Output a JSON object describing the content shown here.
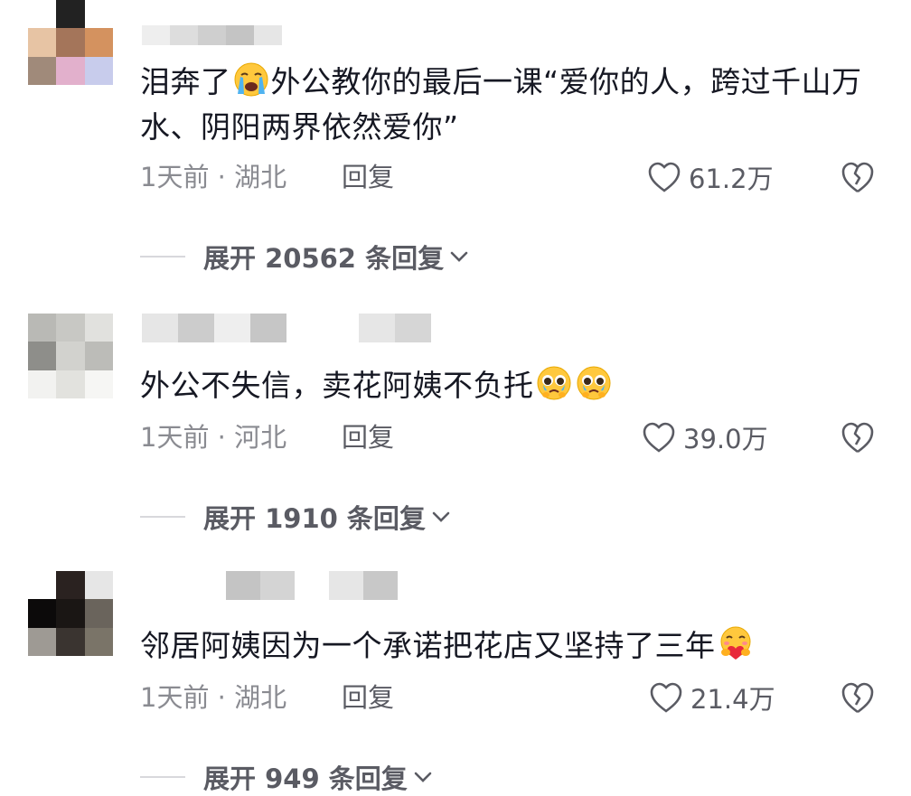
{
  "comments": [
    {
      "username": "",
      "avatar_colors": [
        "#ffffff",
        "#222222",
        "#ffffff",
        "#e7c4a4",
        "#a4755a",
        "#d4925f",
        "#a08a7a",
        "#e2b0cc",
        "#c8ccec"
      ],
      "username_blocks": [
        "#eeeeee",
        "#dddddd",
        "#cfcfcf",
        "#c4c4c4",
        "#e6e6e6"
      ],
      "text_before": "泪奔了",
      "emoji": "crying-face-emoji",
      "text_after": "外公教你的最后一课“爱你的人，跨过千山万水、阴阳两界依然爱你”",
      "time": "1天前 · 湖北",
      "reply_label": "回复",
      "likes": "61.2万",
      "expand_label": "展开 20562 条回复"
    },
    {
      "username": "",
      "avatar_colors": [
        "#b9b9b5",
        "#c8c8c4",
        "#e1e1de",
        "#8e8e8a",
        "#d2d2ce",
        "#bcbcb8",
        "#f2f2f0",
        "#e2e2de",
        "#f6f6f4"
      ],
      "username_blocks": [
        "#e6e6e6",
        "#cccccc",
        "#eeeeee",
        "#c6c6c6",
        "#ffffff",
        "#ffffff",
        "#e6e6e6",
        "#d6d6d6"
      ],
      "text": "外公不失信，卖花阿姨不负托",
      "emojis": [
        "pleading-tears-emoji",
        "pleading-tears-emoji"
      ],
      "time": "1天前 · 河北",
      "reply_label": "回复",
      "likes": "39.0万",
      "expand_label": "展开 1910 条回复"
    },
    {
      "username": "",
      "avatar_colors": [
        "#ffffff",
        "#2a2220",
        "#e6e6e6",
        "#0c0a0a",
        "#1a1614",
        "#6a645c",
        "#9e9a94",
        "#3a3430",
        "#7a7468"
      ],
      "username_blocks": [
        "#c4c4c4",
        "#d4d4d4",
        "#ffffff",
        "#e6e6e6",
        "#c8c8c8"
      ],
      "text": "邻居阿姨因为一个承诺把花店又坚持了三年",
      "emoji": "hugging-heart-emoji",
      "time": "1天前 · 湖北",
      "reply_label": "回复",
      "likes": "21.4万",
      "expand_label": "展开 949 条回复"
    }
  ],
  "icons": {
    "like": "heart-outline-icon",
    "dislike": "broken-heart-icon",
    "expand": "chevron-down-icon"
  },
  "colors": {
    "text_primary": "#161823",
    "text_secondary": "#8a8b91",
    "action": "#5a5b63"
  }
}
